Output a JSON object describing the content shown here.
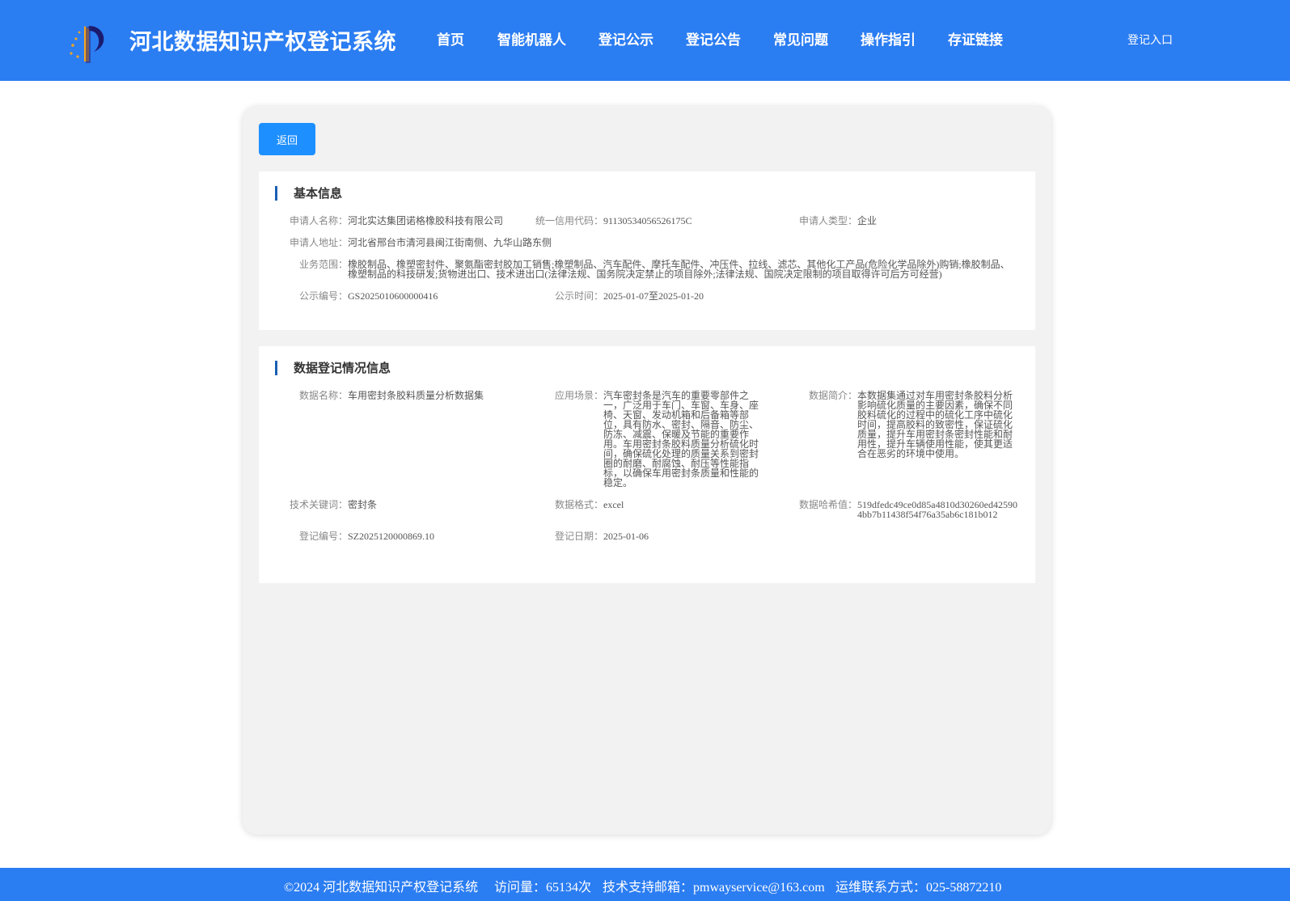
{
  "header": {
    "title": "河北数据知识产权登记系统",
    "nav": [
      "首页",
      "智能机器人",
      "登记公示",
      "登记公告",
      "常见问题",
      "操作指引",
      "存证链接"
    ],
    "login": "登记入口"
  },
  "colors": {
    "header_bg": "#2b7df2",
    "button_bg": "#1e8fff",
    "accent_bar": "#1a5fb4",
    "panel_bg": "#f2f2f2"
  },
  "back_button": "返回",
  "basic_info": {
    "title": "基本信息",
    "applicant_name_label": "申请人名称：",
    "applicant_name": "河北实达集团诺格橡胶科技有限公司",
    "credit_code_label": "统一信用代码：",
    "credit_code": "91130534056526175C",
    "applicant_type_label": "申请人类型：",
    "applicant_type": "企业",
    "address_label": "申请人地址：",
    "address": "河北省邢台市清河县闽江街南侧、九华山路东侧",
    "scope_label": "业务范围：",
    "scope": "橡胶制品、橡塑密封件、聚氨酯密封胶加工销售;橡塑制品、汽车配件、摩托车配件、冲压件、拉线、滤芯、其他化工产品(危险化学品除外)购销;橡胶制品、橡塑制品的科技研发;货物进出口、技术进出口(法律法规、国务院决定禁止的项目除外;法律法规、国院决定限制的项目取得许可后方可经营)",
    "notice_no_label": "公示编号：",
    "notice_no": "GS2025010600000416",
    "notice_time_label": "公示时间：",
    "notice_time": "2025-01-07至2025-01-20"
  },
  "data_info": {
    "title": "数据登记情况信息",
    "name_label": "数据名称：",
    "name": "车用密封条胶料质量分析数据集",
    "scene_label": "应用场景：",
    "scene": "汽车密封条是汽车的重要零部件之一，广泛用于车门、车窗、车身、座椅、天窗、发动机箱和后备箱等部位，具有防水、密封、隔音、防尘、防冻、减震、保暖及节能的重要作用。车用密封条胶料质量分析硫化时间，确保硫化处理的质量关系到密封圈的耐磨、耐腐蚀、耐压等性能指标，以确保车用密封条质量和性能的稳定。",
    "intro_label": "数据简介：",
    "intro": "本数据集通过对车用密封条胶料分析影响硫化质量的主要因素，确保不同胶料硫化的过程中的硫化工序中硫化时间，提高胶料的致密性，保证硫化质量，提升车用密封条密封性能和耐用性，提升车辆使用性能，使其更适合在恶劣的环境中使用。",
    "keyword_label": "技术关键词：",
    "keyword": "密封条",
    "format_label": "数据格式：",
    "format": "excel",
    "hash_label": "数据哈希值：",
    "hash": "519dfedc49ce0d85a4810d30260ed425904bb7b11438f54f76a35ab6c181b012",
    "reg_no_label": "登记编号：",
    "reg_no": "SZ2025120000869.10",
    "reg_date_label": "登记日期：",
    "reg_date": "2025-01-06"
  },
  "footer": {
    "copyright": "©2024 河北数据知识产权登记系统",
    "visits": "访问量：65134次",
    "support": "技术支持邮箱：pmwayservice@163.com",
    "ops": "运维联系方式：025-58872210"
  }
}
